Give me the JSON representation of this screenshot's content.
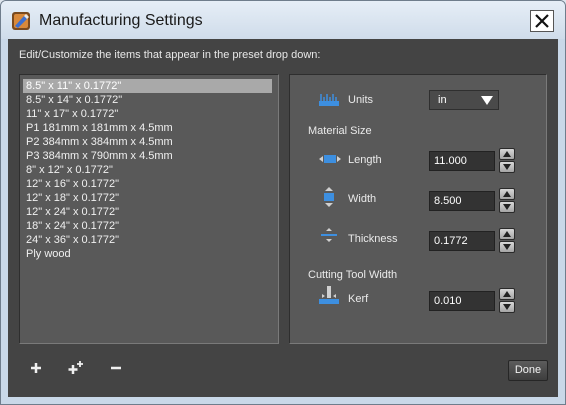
{
  "window": {
    "title": "Manufacturing Settings"
  },
  "instructions": "Edit/Customize the items that appear in the preset drop down:",
  "presets": [
    "8.5\" x 11\" x 0.1772\"",
    "8.5\" x 14\" x 0.1772\"",
    "11\" x 17\" x 0.1772\"",
    "P1 181mm x 181mm x 4.5mm",
    "P2 384mm x 384mm x 4.5mm",
    "P3 384mm x 790mm x 4.5mm",
    "8\" x 12\" x 0.1772\"",
    "12\" x 16\" x 0.1772\"",
    "12\" x 18\" x 0.1772\"",
    "12\" x 24\" x 0.1772\"",
    "18\" x 24\" x 0.1772\"",
    "24\" x 36\" x 0.1772\"",
    "Ply wood"
  ],
  "selected_index": 0,
  "settings": {
    "units_label": "Units",
    "units_value": "in",
    "material_size_heading": "Material Size",
    "length_label": "Length",
    "length_value": "11.000",
    "width_label": "Width",
    "width_value": "8.500",
    "thickness_label": "Thickness",
    "thickness_value": "0.1772",
    "cutting_tool_heading": "Cutting Tool Width",
    "kerf_label": "Kerf",
    "kerf_value": "0.010"
  },
  "buttons": {
    "done": "Done"
  },
  "colors": {
    "accent": "#3d8fe0",
    "panel": "#595959",
    "client": "#444444"
  }
}
